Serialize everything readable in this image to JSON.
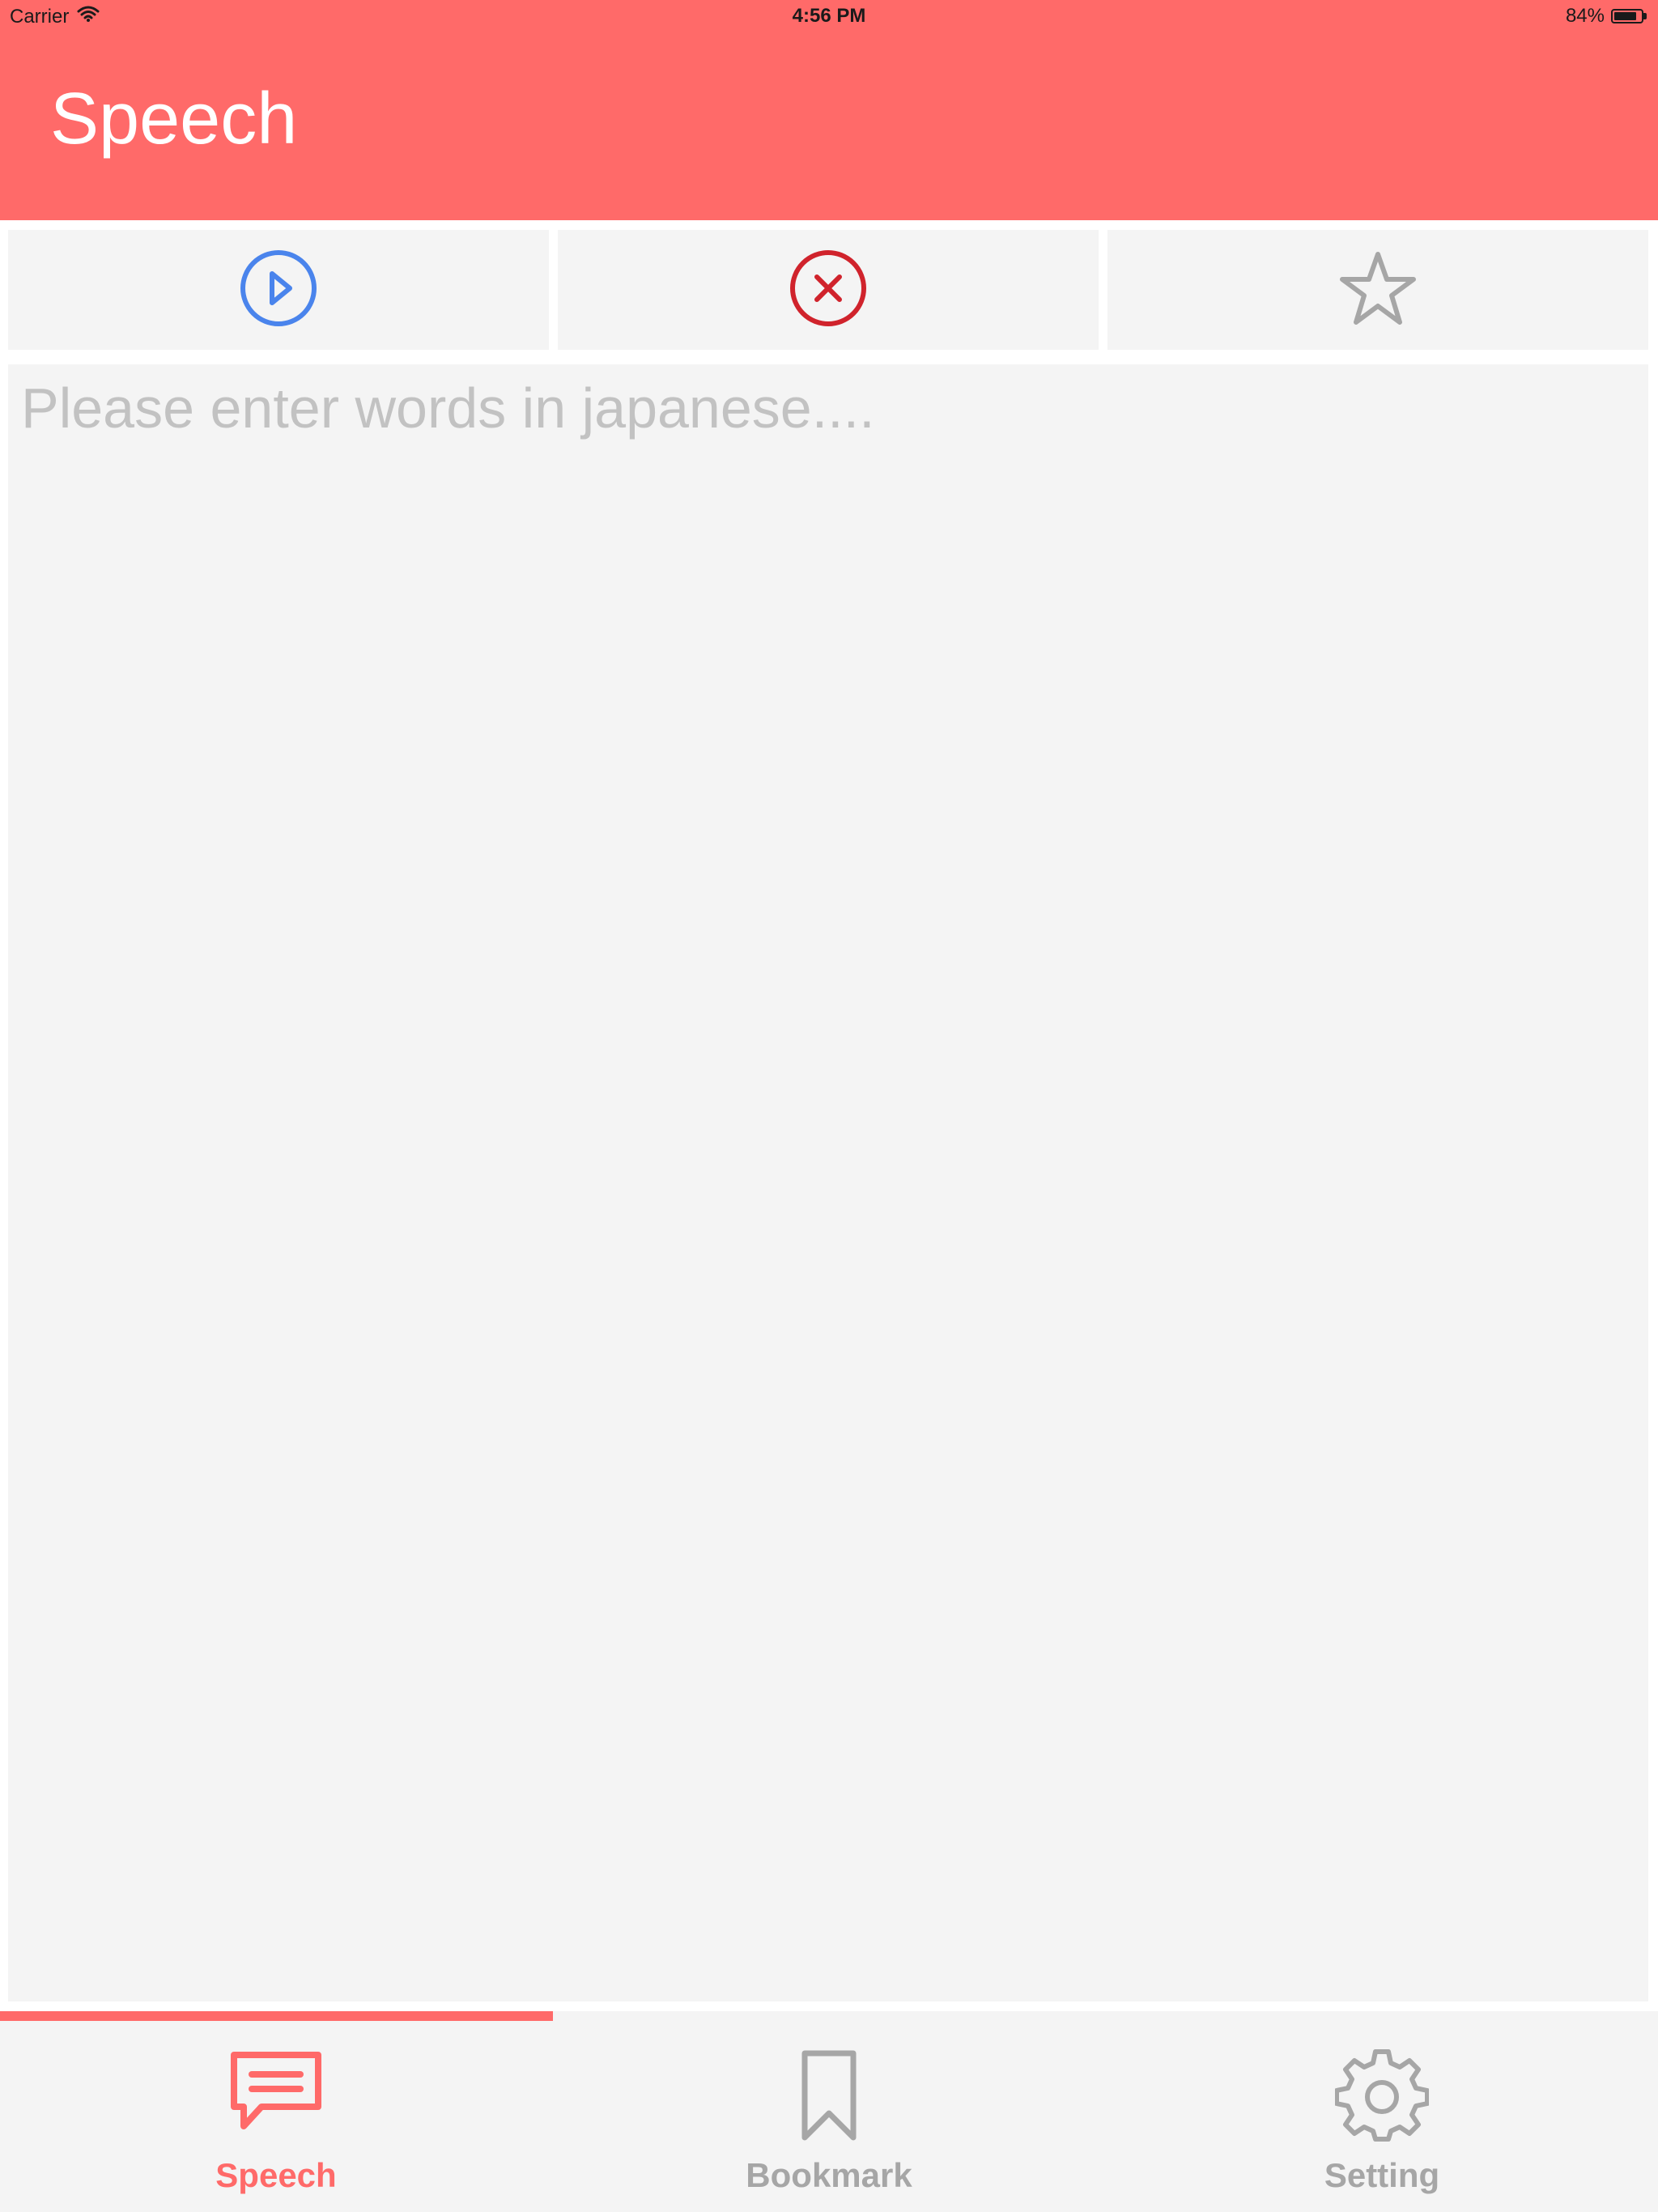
{
  "status_bar": {
    "carrier": "Carrier",
    "time": "4:56 PM",
    "battery_text": "84%",
    "battery_level": 0.84
  },
  "header": {
    "title": "Speech"
  },
  "toolbar": {
    "play_icon": "play-circle-icon",
    "clear_icon": "close-circle-icon",
    "bookmark_icon": "star-outline-icon"
  },
  "editor": {
    "placeholder": "Please enter words in japanese....",
    "value": ""
  },
  "tabbar": {
    "active_index": 0,
    "tabs": [
      {
        "label": "Speech",
        "icon": "speech-bubble-icon"
      },
      {
        "label": "Bookmark",
        "icon": "bookmark-icon"
      },
      {
        "label": "Setting",
        "icon": "gear-icon"
      }
    ]
  },
  "colors": {
    "accent": "#ff6a69",
    "play": "#4a84ec",
    "clear": "#d0232c",
    "inactive": "#a6a6a6",
    "background": "#f4f4f4"
  }
}
